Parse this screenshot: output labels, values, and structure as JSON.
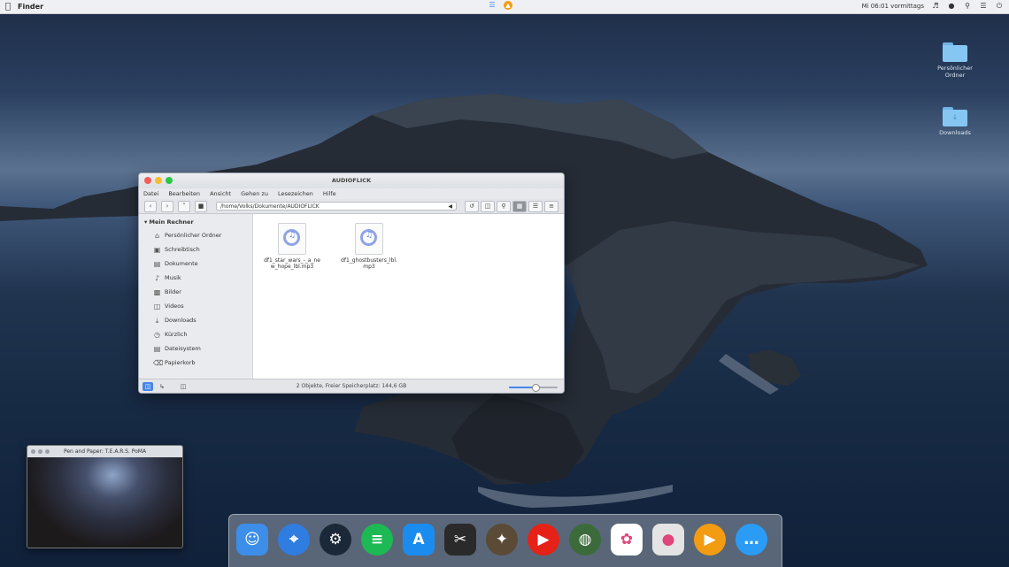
{
  "menubar": {
    "app_name": "Finder",
    "right_status": "Mi 06:01 vormittags"
  },
  "desktop_icons": [
    {
      "label": "Persönlicher Ordner",
      "icon": "folder-icon"
    },
    {
      "label": "Downloads",
      "icon": "download-folder-icon"
    }
  ],
  "finder": {
    "title": "AUDIOFLICK",
    "menu": [
      "Datei",
      "Bearbeiten",
      "Ansicht",
      "Gehen zu",
      "Lesezeichen",
      "Hilfe"
    ],
    "path": "/home/Volks/Dokumente/AUDIOFLICK",
    "sidebar_heading": "Mein Rechner",
    "sidebar_items": [
      {
        "label": "Persönlicher Ordner",
        "icon": "home-icon"
      },
      {
        "label": "Schreibtisch",
        "icon": "desktop-icon"
      },
      {
        "label": "Dokumente",
        "icon": "documents-icon"
      },
      {
        "label": "Musik",
        "icon": "music-icon"
      },
      {
        "label": "Bilder",
        "icon": "pictures-icon"
      },
      {
        "label": "Videos",
        "icon": "videos-icon"
      },
      {
        "label": "Downloads",
        "icon": "downloads-icon"
      },
      {
        "label": "Kürzlich",
        "icon": "recent-icon"
      },
      {
        "label": "Dateisystem",
        "icon": "filesystem-icon"
      },
      {
        "label": "Papierkorb",
        "icon": "trash-icon"
      }
    ],
    "files": [
      {
        "name": "df1_star_wars_-_a_new_hope_lbl.mp3",
        "icon": "audio-file-icon"
      },
      {
        "name": "df1_ghostbusters_lbl.mp3",
        "icon": "audio-file-icon"
      }
    ],
    "status": "2 Objekte, Freier Speicherplatz: 144,6 GB",
    "zoom_level": 0.55
  },
  "video": {
    "title": "Pen and Paper: T.E.A.R.S. PoMA"
  },
  "dock": [
    {
      "name": "Finder",
      "icon": "finder-icon",
      "color": "#3d8ee8"
    },
    {
      "name": "Safari",
      "icon": "safari-icon",
      "color": "#2f7de1"
    },
    {
      "name": "Steam",
      "icon": "steam-icon",
      "color": "#1b2838"
    },
    {
      "name": "Spotify",
      "icon": "spotify-icon",
      "color": "#1db954"
    },
    {
      "name": "App Store",
      "icon": "app-store-icon",
      "color": "#1a8cf0"
    },
    {
      "name": "Final Cut Pro",
      "icon": "clapper-icon",
      "color": "#2a2a2a"
    },
    {
      "name": "Counter-Strike",
      "icon": "counter-strike-icon",
      "color": "#5a4a36"
    },
    {
      "name": "YouTube",
      "icon": "youtube-icon",
      "color": "#e62117"
    },
    {
      "name": "Minecraft",
      "icon": "globe-icon",
      "color": "#3b6b3a"
    },
    {
      "name": "Photos",
      "icon": "photos-icon",
      "color": "#ffffff"
    },
    {
      "name": "Game Center",
      "icon": "game-center-icon",
      "color": "#e4e4e4"
    },
    {
      "name": "Player",
      "icon": "play-icon",
      "color": "#f39c12"
    },
    {
      "name": "Messages",
      "icon": "messages-icon",
      "color": "#2b9cf6"
    }
  ]
}
